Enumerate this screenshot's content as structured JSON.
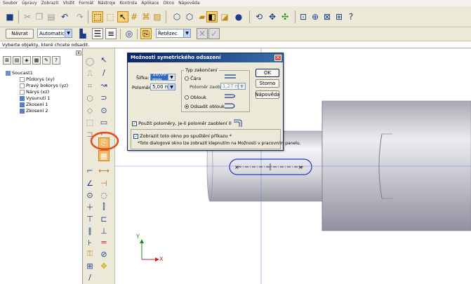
{
  "menu": [
    "Soubor",
    "Úpravy",
    "Zobrazit",
    "Vložit",
    "Formát",
    "Nástroje",
    "Kontrola",
    "Aplikace",
    "Okno",
    "Nápověda"
  ],
  "toolbar2": {
    "navrat_label": "Návrat",
    "mode_value": "Automaticky",
    "chain_value": "Řetězec"
  },
  "prompt": "Vyberte objekty, které chcete odsadit.",
  "tree": {
    "root": "Soucast1",
    "items": [
      "Půdorys (xy)",
      "Pravý bokorys (yz)",
      "Nárys (xz)",
      "Vysunutí 1",
      "Zkosení 1",
      "Zkosení 2"
    ]
  },
  "dialog": {
    "title": "Možnosti symetrického odsazení",
    "sirka_label": "Šířka:",
    "sirka_value": "10,00 mm",
    "polomer_label": "Poloměr:",
    "polomer_value": "5,00 mm",
    "typ_group": "Typ zakončení",
    "cara_label": "Čára",
    "polomer_zaobleni_label": "Poloměr zaoblení:",
    "polomer_zaobleni_value": "1,27 mm",
    "oblouk_label": "Oblouk",
    "odsadit_label": "Odsadit oblouk",
    "ok_label": "OK",
    "storno_label": "Storno",
    "napoveda_label": "Nápověda",
    "pouzit_label": "Použít poloměry, je-li poloměr zaoblení 0",
    "zobrazit_label": "Zobrazit toto okno po spuštění příkazu *",
    "note": "*Toto dialogové okno lze zobrazit klepnutím na Možnosti v pracovním panelu."
  },
  "axes": {
    "x_label": "X",
    "y_label": "Y"
  },
  "colors": {
    "highlight": "#e84a1a",
    "title_bar": "#0a246a",
    "sketch_blue": "#1a3dbd"
  }
}
